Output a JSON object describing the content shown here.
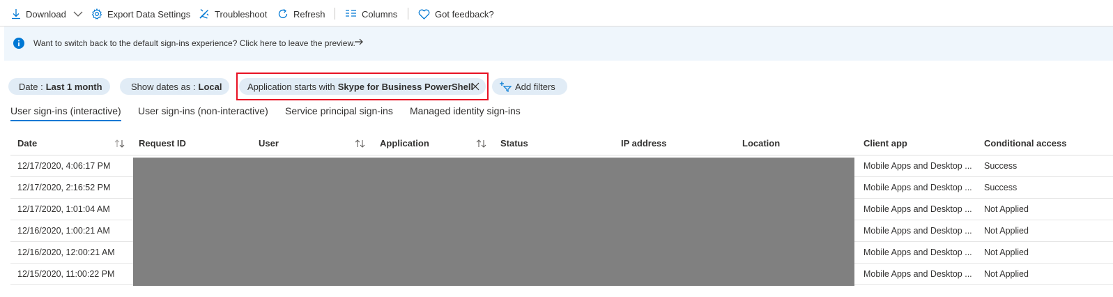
{
  "toolbar": {
    "download": "Download",
    "export": "Export Data Settings",
    "troubleshoot": "Troubleshoot",
    "refresh": "Refresh",
    "columns": "Columns",
    "feedback": "Got feedback?"
  },
  "banner": {
    "text": "Want to switch back to the default sign-ins experience? Click here to leave the preview."
  },
  "filters": {
    "date_label": "Date :",
    "date_value": "Last 1 month",
    "show_dates_label": "Show dates as :",
    "show_dates_value": "Local",
    "application_label": "Application starts with",
    "application_value": "Skype for Business PowerShell",
    "add_filters": "Add filters"
  },
  "tabs": [
    "User sign-ins (interactive)",
    "User sign-ins (non-interactive)",
    "Service principal sign-ins",
    "Managed identity sign-ins"
  ],
  "columns": [
    "Date",
    "Request ID",
    "User",
    "Application",
    "Status",
    "IP address",
    "Location",
    "Client app",
    "Conditional access"
  ],
  "rows": [
    {
      "date": "12/17/2020, 4:06:17 PM",
      "client_app": "Mobile Apps and Desktop ...",
      "conditional_access": "Success"
    },
    {
      "date": "12/17/2020, 2:16:52 PM",
      "client_app": "Mobile Apps and Desktop ...",
      "conditional_access": "Success"
    },
    {
      "date": "12/17/2020, 1:01:04 AM",
      "client_app": "Mobile Apps and Desktop ...",
      "conditional_access": "Not Applied"
    },
    {
      "date": "12/16/2020, 1:00:21 AM",
      "client_app": "Mobile Apps and Desktop ...",
      "conditional_access": "Not Applied"
    },
    {
      "date": "12/16/2020, 12:00:21 AM",
      "client_app": "Mobile Apps and Desktop ...",
      "conditional_access": "Not Applied"
    },
    {
      "date": "12/15/2020, 11:00:22 PM",
      "client_app": "Mobile Apps and Desktop ...",
      "conditional_access": "Not Applied"
    }
  ],
  "colors": {
    "accent": "#0078d4",
    "highlight_border": "#e81123",
    "pill_bg": "#e1ecf6",
    "banner_bg": "#eff6fc",
    "redaction": "#808080"
  },
  "icons": {
    "download": "download-icon",
    "download_menu": "chevron-down-icon",
    "export": "gear-icon",
    "troubleshoot": "wrench-icon",
    "refresh": "refresh-icon",
    "columns": "columns-icon",
    "feedback": "heart-icon",
    "banner": "info-icon",
    "banner_arrow": "arrow-right-icon",
    "filter_remove": "close-icon",
    "add_filter": "add-filter-icon",
    "sort": "sort-icon"
  }
}
